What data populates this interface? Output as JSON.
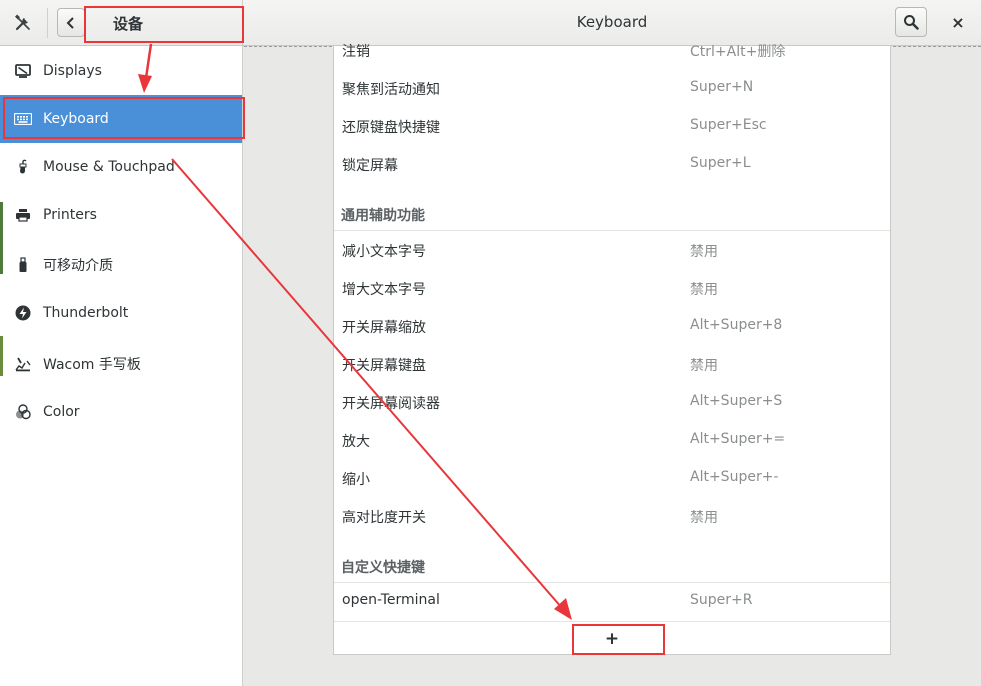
{
  "header": {
    "panel_title": "设备",
    "window_title": "Keyboard",
    "tools_icon": "tools-icon",
    "back_icon": "chevron-left-icon",
    "search_icon": "search-icon",
    "close_label": "×"
  },
  "sidebar": {
    "items": [
      {
        "label": "Displays",
        "icon": "display-icon"
      },
      {
        "label": "Keyboard",
        "icon": "keyboard-icon",
        "selected": true
      },
      {
        "label": "Mouse & Touchpad",
        "icon": "mouse-icon"
      },
      {
        "label": "Printers",
        "icon": "printer-icon"
      },
      {
        "label": "可移动介质",
        "icon": "usb-drive-icon"
      },
      {
        "label": "Thunderbolt",
        "icon": "thunderbolt-icon"
      },
      {
        "label": "Wacom 手写板",
        "icon": "tablet-icon"
      },
      {
        "label": "Color",
        "icon": "color-icon"
      }
    ]
  },
  "shortcuts": {
    "system_rows": [
      {
        "name": "注销",
        "accel": "Ctrl+Alt+删除"
      },
      {
        "name": "聚焦到活动通知",
        "accel": "Super+N"
      },
      {
        "name": "还原键盘快捷键",
        "accel": "Super+Esc"
      },
      {
        "name": "锁定屏幕",
        "accel": "Super+L"
      }
    ],
    "accessibility_title": "通用辅助功能",
    "accessibility_rows": [
      {
        "name": "减小文本字号",
        "accel": "禁用"
      },
      {
        "name": "增大文本字号",
        "accel": "禁用"
      },
      {
        "name": "开关屏幕缩放",
        "accel": "Alt+Super+8"
      },
      {
        "name": "开关屏幕键盘",
        "accel": "禁用"
      },
      {
        "name": "开关屏幕阅读器",
        "accel": "Alt+Super+S"
      },
      {
        "name": "放大",
        "accel": "Alt+Super+="
      },
      {
        "name": "缩小",
        "accel": "Alt+Super+-"
      },
      {
        "name": "高对比度开关",
        "accel": "禁用"
      }
    ],
    "custom_title": "自定义快捷键",
    "custom_rows": [
      {
        "name": "open-Terminal",
        "accel": "Super+R"
      }
    ],
    "add_label": "+"
  },
  "colors": {
    "accent": "#4a90d9",
    "annotation": "#e8363a"
  }
}
